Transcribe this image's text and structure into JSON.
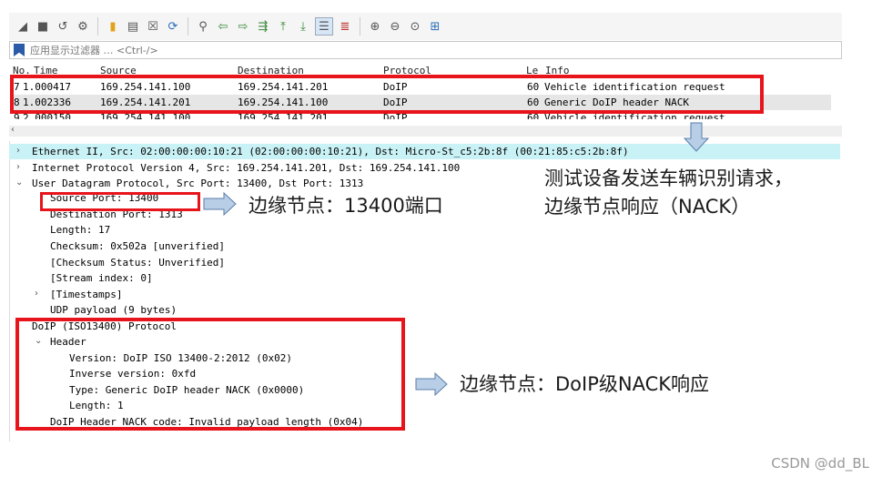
{
  "filter": {
    "placeholder": "应用显示过滤器 … <Ctrl-/>"
  },
  "packet_list": {
    "columns": [
      "No.",
      "Time",
      "Source",
      "Destination",
      "Protocol",
      "Le",
      "Info"
    ],
    "rows": [
      {
        "no": "7",
        "time": "1.000417",
        "src": "169.254.141.100",
        "dst": "169.254.141.201",
        "proto": "DoIP",
        "len": "60",
        "info": "Vehicle identification request"
      },
      {
        "no": "8",
        "time": "1.002336",
        "src": "169.254.141.201",
        "dst": "169.254.141.100",
        "proto": "DoIP",
        "len": "60",
        "info": "Generic DoIP header NACK"
      },
      {
        "no": "9",
        "time": "2.000150",
        "src": "169.254.141.100",
        "dst": "169.254.141.201",
        "proto": "DoIP",
        "len": "60",
        "info": "Vehicle identification request"
      }
    ]
  },
  "details": {
    "ethernet": "Ethernet II, Src: 02:00:00:00:10:21 (02:00:00:00:10:21), Dst: Micro-St_c5:2b:8f (00:21:85:c5:2b:8f)",
    "ip": "Internet Protocol Version 4, Src: 169.254.141.201, Dst: 169.254.141.100",
    "udp": "User Datagram Protocol, Src Port: 13400, Dst Port: 1313",
    "src_port": "Source Port: 13400",
    "dst_port": "Destination Port: 1313",
    "length": "Length: 17",
    "checksum": "Checksum: 0x502a [unverified]",
    "checksum_status": "[Checksum Status: Unverified]",
    "stream_index": "[Stream index: 0]",
    "timestamps": "[Timestamps]",
    "udp_payload": "UDP payload (9 bytes)",
    "doip": "DoIP (ISO13400) Protocol",
    "header": "Header",
    "version": "Version: DoIP ISO 13400-2:2012 (0x02)",
    "inverse_version": "Inverse version: 0xfd",
    "type": "Type: Generic DoIP header NACK (0x0000)",
    "hdr_length": "Length: 1",
    "nack_code": "DoIP Header NACK code: Invalid payload length (0x04)"
  },
  "annotations": {
    "port_note": "边缘节点：13400端口",
    "request_line1": "测试设备发送车辆识别请求，",
    "request_line2": "边缘节点响应（NACK）",
    "doip_note": "边缘节点：DoIP级NACK响应"
  },
  "watermark": "CSDN @dd_BL",
  "colors": {
    "highlight_red": "#e8141c",
    "eth_row_bg": "#c9f2f6",
    "arrow_fill": "#b8cde6"
  }
}
